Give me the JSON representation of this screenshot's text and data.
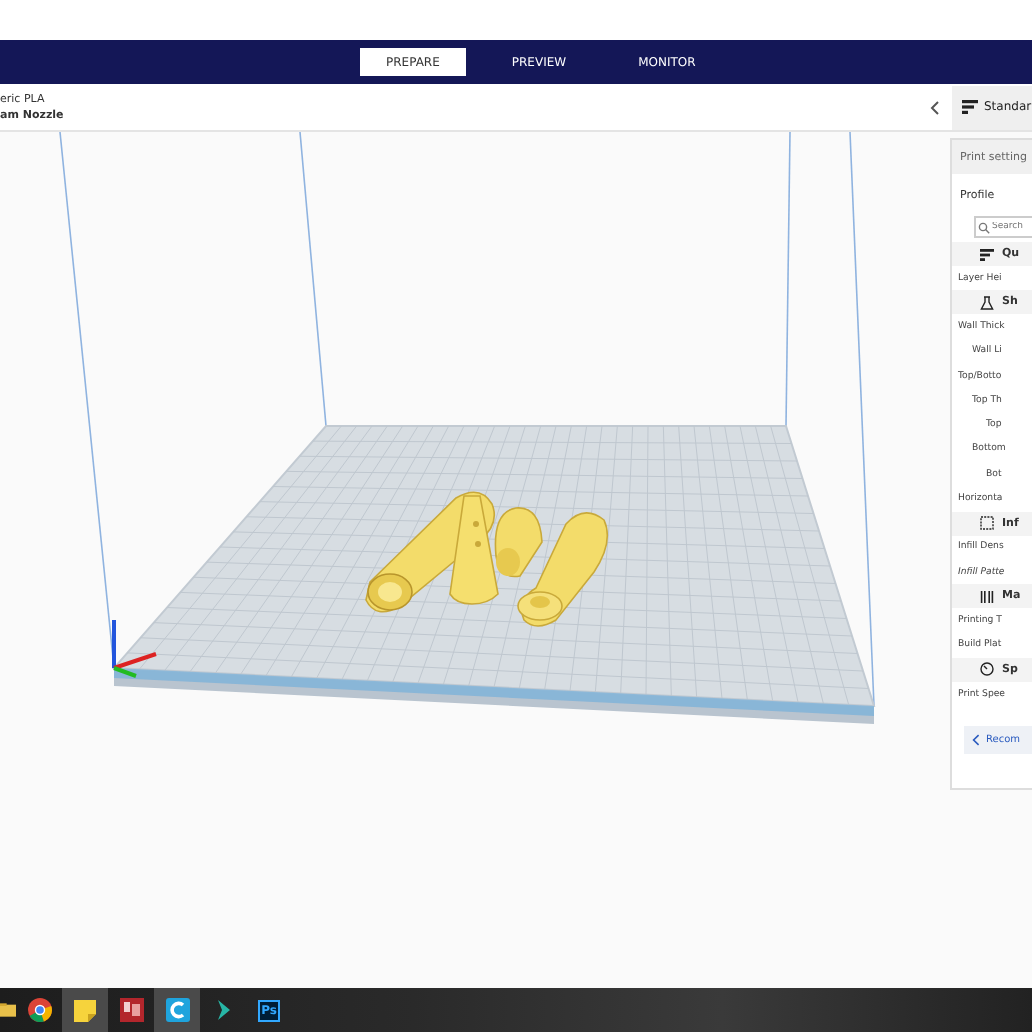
{
  "header": {
    "tabs": [
      {
        "label": "PREPARE",
        "selected": true
      },
      {
        "label": "PREVIEW",
        "selected": false
      },
      {
        "label": "MONITOR",
        "selected": false
      }
    ]
  },
  "material_info": {
    "material": "eric PLA",
    "nozzle": "am Nozzle"
  },
  "settings_panel": {
    "profile_button": "Standar",
    "title": "Print setting",
    "profile_label": "Profile",
    "search": {
      "placeholder": "Search"
    },
    "sections": [
      {
        "kind": "quality",
        "title": "Qu",
        "settings": [
          {
            "label": "Layer Hei",
            "italic": false
          }
        ]
      },
      {
        "kind": "shell",
        "title": "Sh",
        "settings": [
          {
            "label": "Wall Thick",
            "italic": false,
            "children": [
              {
                "label": "Wall Li",
                "italic": false
              }
            ]
          },
          {
            "label": "Top/Botto",
            "italic": false,
            "children": [
              {
                "label": "Top Th",
                "italic": false,
                "children": [
                  {
                    "label": "Top",
                    "italic": false
                  }
                ]
              },
              {
                "label": "Bottom",
                "italic": false,
                "children": [
                  {
                    "label": "Bot",
                    "italic": false
                  }
                ]
              }
            ]
          },
          {
            "label": "Horizonta",
            "italic": false
          }
        ]
      },
      {
        "kind": "infill",
        "title": "Inf",
        "settings": [
          {
            "label": "Infill Dens",
            "italic": false
          },
          {
            "label": "Infill Patte",
            "italic": true
          }
        ]
      },
      {
        "kind": "material",
        "title": "Ma",
        "settings": [
          {
            "label": "Printing T",
            "italic": false
          },
          {
            "label": "Build Plat",
            "italic": false
          }
        ]
      },
      {
        "kind": "speed",
        "title": "Sp",
        "settings": [
          {
            "label": "Print Spee",
            "italic": false
          }
        ]
      }
    ],
    "recommended_button": "Recom"
  },
  "taskbar": {
    "apps": [
      {
        "kind": "folder"
      },
      {
        "kind": "chrome"
      },
      {
        "kind": "notes"
      },
      {
        "kind": "red-app"
      },
      {
        "kind": "cura"
      },
      {
        "kind": "arrow"
      },
      {
        "kind": "photoshop",
        "label": "Ps"
      }
    ]
  }
}
